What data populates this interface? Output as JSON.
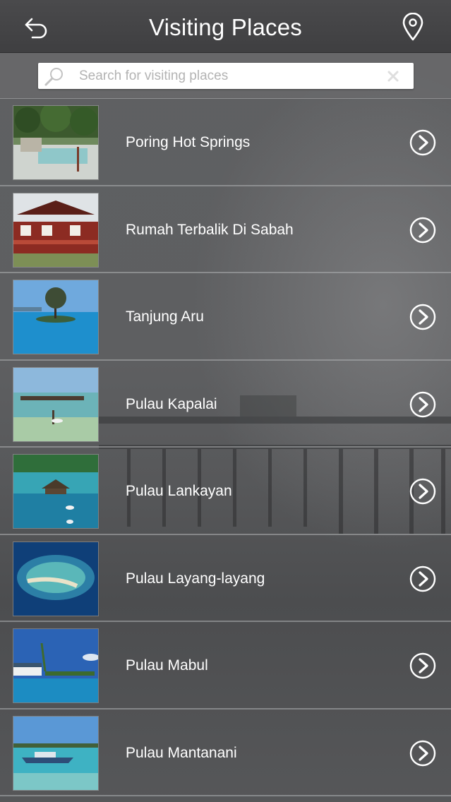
{
  "header": {
    "title": "Visiting Places",
    "back_icon": "back-arrow-icon",
    "location_icon": "map-pin-icon"
  },
  "search": {
    "placeholder": "Search for visiting places",
    "value": "",
    "search_icon": "magnifier-icon",
    "clear_icon": "clear-x-icon"
  },
  "places": [
    {
      "name": "Poring Hot Springs"
    },
    {
      "name": "Rumah Terbalik Di Sabah"
    },
    {
      "name": "Tanjung Aru"
    },
    {
      "name": "Pulau Kapalai"
    },
    {
      "name": "Pulau Lankayan"
    },
    {
      "name": "Pulau Layang-layang"
    },
    {
      "name": "Pulau Mabul"
    },
    {
      "name": "Pulau Mantanani"
    }
  ],
  "colors": {
    "nav_bg": "#434345",
    "text": "#ffffff",
    "divider": "#afb0b2"
  }
}
